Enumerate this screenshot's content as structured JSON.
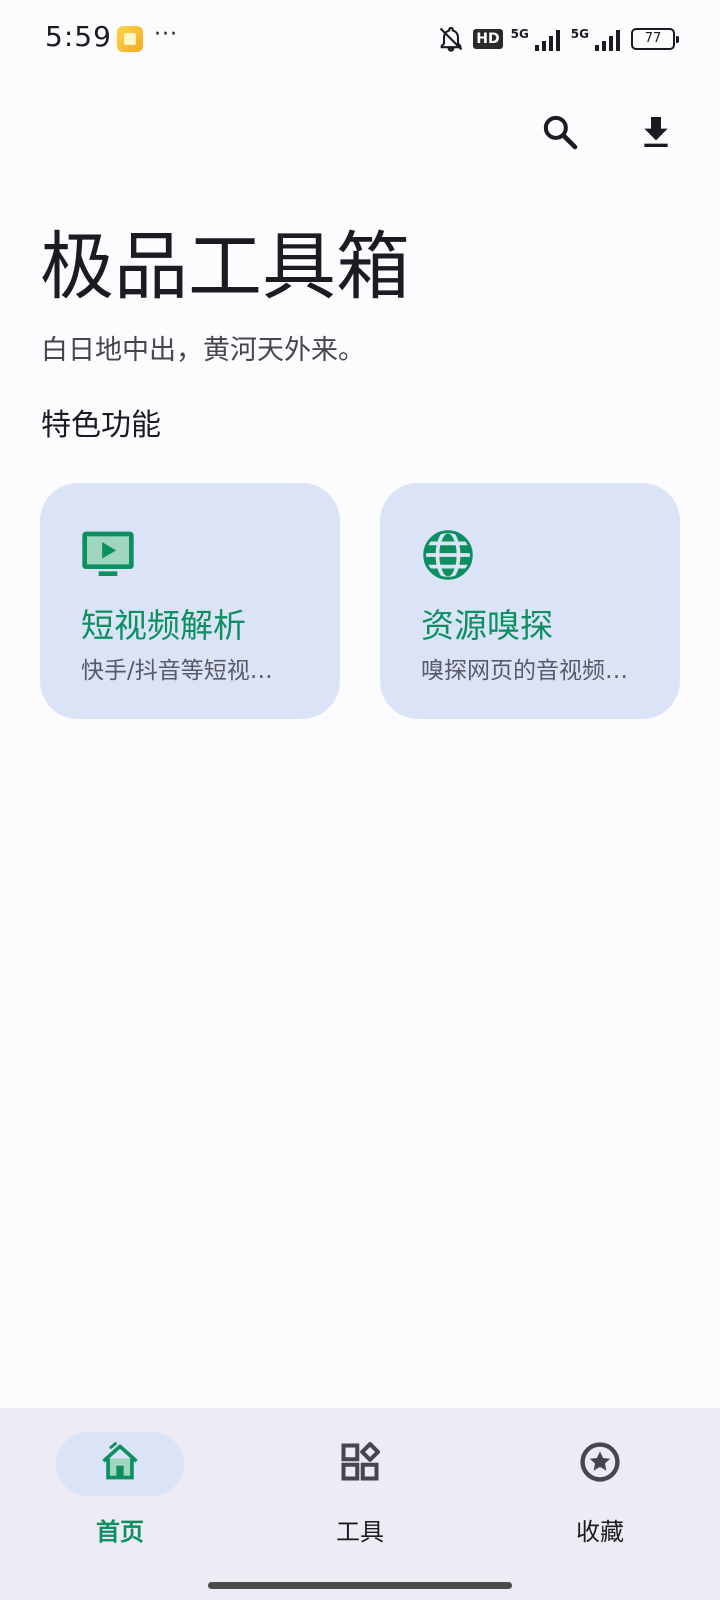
{
  "status_bar": {
    "time": "5:59",
    "more": "···",
    "hd_label": "HD",
    "network_1": "5G",
    "network_2": "5G",
    "battery": "77"
  },
  "header": {
    "search_icon": "search-icon",
    "download_icon": "download-icon"
  },
  "main": {
    "title": "极品工具箱",
    "subtitle": "白日地中出，黄河天外来。",
    "section_title": "特色功能",
    "cards": [
      {
        "title": "短视频解析",
        "description": "快手/抖音等短视…",
        "icon": "tv-play-icon"
      },
      {
        "title": "资源嗅探",
        "description": "嗅探网页的音视频…",
        "icon": "globe-icon"
      }
    ]
  },
  "bottom_nav": {
    "items": [
      {
        "label": "首页",
        "icon": "home-icon",
        "selected": true
      },
      {
        "label": "工具",
        "icon": "widgets-icon",
        "selected": false
      },
      {
        "label": "收藏",
        "icon": "star-circle-icon",
        "selected": false
      }
    ]
  },
  "colors": {
    "accent": "#0d8f62",
    "card_background": "#dbe4f7",
    "page_background": "#fcfbfe",
    "nav_background": "#efebf4"
  }
}
